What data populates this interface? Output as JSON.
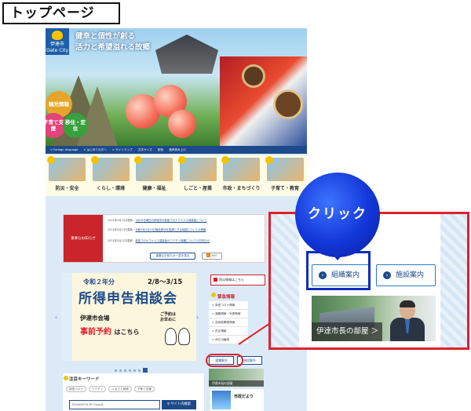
{
  "page_heading": "トップページ",
  "hero": {
    "logo_name": "伊達市",
    "logo_sub": "Date City",
    "slogan": "健幸と個性が創る\n活力と希望溢れる故郷",
    "buttons": {
      "kanko": "観光情報",
      "kosodate": "子育て支援",
      "iju": "移住・定住"
    }
  },
  "utility_bar": [
    "> Foreign language",
    "> はじめての方へ",
    "> サイトマップ",
    "文字サイズ",
    "配色",
    "音声読み上げ"
  ],
  "categories": [
    {
      "label": "防災・安全",
      "icon": "alert-icon"
    },
    {
      "label": "くらし・環境",
      "icon": "home-icon"
    },
    {
      "label": "健康・福祉",
      "icon": "heart-icon"
    },
    {
      "label": "しごと・産業",
      "icon": "briefcase-icon"
    },
    {
      "label": "市政・まちづくり",
      "icon": "building-icon"
    },
    {
      "label": "子育て・教育",
      "icon": "child-icon"
    }
  ],
  "notice": {
    "heading": "重要なお知らせ",
    "items": [
      {
        "date": "2021年2月23日更新",
        "text": "2月23日現在の伊達市の新型コロナウイルス感染症について"
      },
      {
        "date": "2021年2月13日更新",
        "text": "令和3年2月13日福島県沖を震源とする地震についての情報"
      },
      {
        "date": "2021年2月12日更新",
        "text": "新型コロナウイルス感染症のワクチン接種についてのお知らせ"
      }
    ],
    "more_button": "重要なお知らせ一覧を見る",
    "rss_button": "RSS"
  },
  "banner": {
    "year": "令和２年分",
    "date": "2/8～3/15",
    "title": "所得申告相談会",
    "venue": "伊達市会場",
    "note": "ご予約は\nお早めに",
    "reserve": "事前予約",
    "reserve_suffix": "はこちら"
  },
  "right_column": {
    "disaster_button": "防災情報はこちら",
    "emergency_title": "緊急情報",
    "emergency_items": [
      "> 新型コロナ情報",
      "> 避難情報・気象警報",
      "> 放射能関連情報",
      "> 防災情報",
      "> 休日当番医"
    ],
    "org_button": "組織案内",
    "facility_button": "施設案内",
    "mayor_label": "伊達市長の部屋",
    "koho_label": "市政だより"
  },
  "keywords": {
    "title": "注目キーワード",
    "tags": [
      "新型コロナ",
      "ワクチン",
      "ふるさと納税",
      "子育て支援"
    ]
  },
  "search": {
    "placeholder": "ENHANCED BY Google",
    "button": "サイト内検索"
  },
  "zoom": {
    "org_button": "組織案内",
    "facility_button": "施設案内",
    "mayor_label": "伊達市長の部屋 ＞"
  },
  "click_label": "クリック",
  "colors": {
    "brand_blue": "#1c4a8a",
    "alert_red": "#e0212b",
    "callout_blue": "#0d2dbb",
    "accent_yellow": "#f2c300"
  }
}
